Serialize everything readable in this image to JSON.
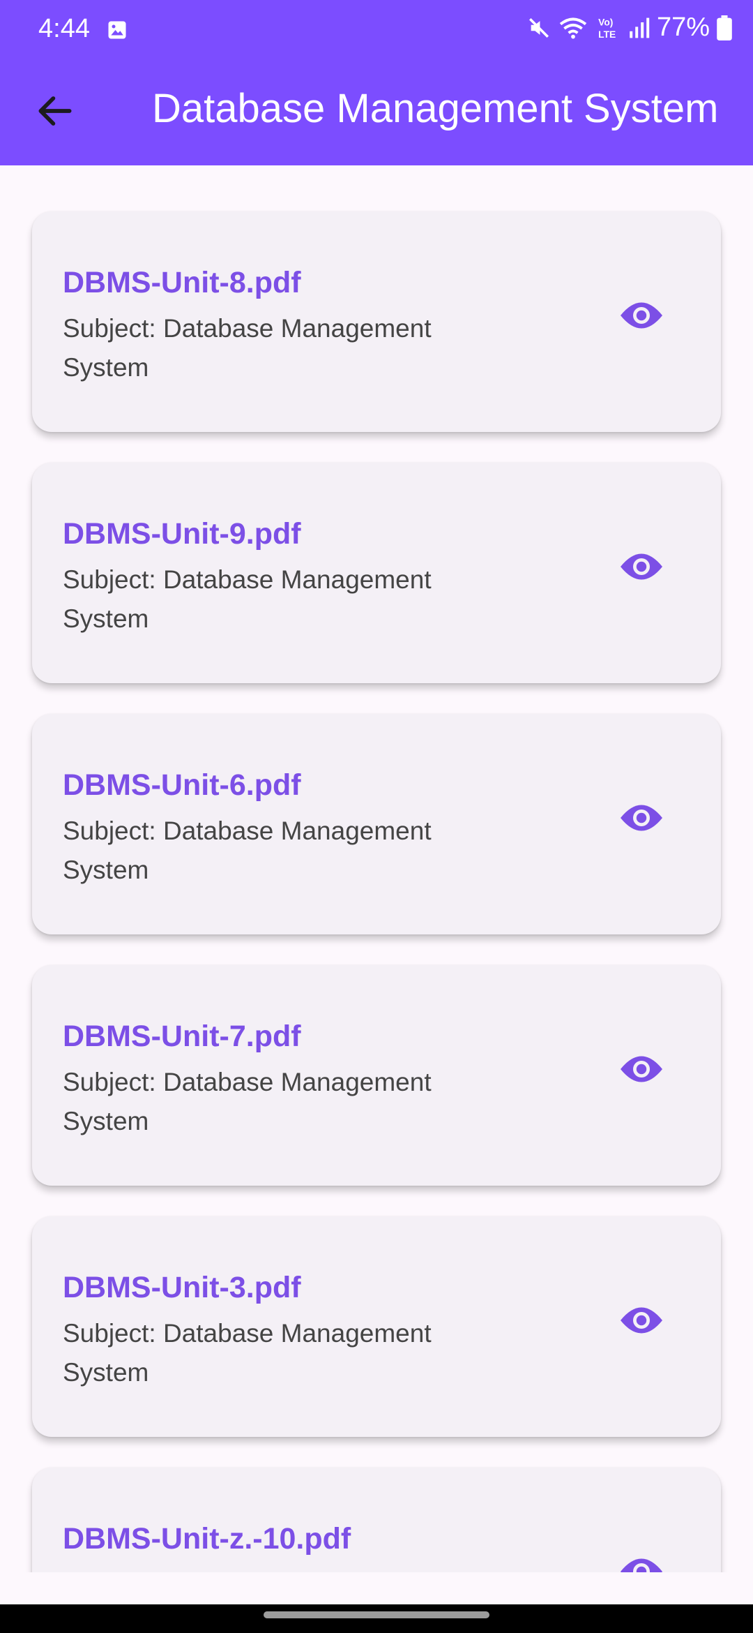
{
  "status_bar": {
    "time": "4:44",
    "battery": "77%",
    "icons": [
      "gallery-icon",
      "mute-icon",
      "wifi-icon",
      "volte-icon",
      "signal-icon",
      "battery-icon"
    ]
  },
  "app_bar": {
    "title": "Database Management System",
    "back_icon": "arrow-back-icon",
    "color": "#7c4dff"
  },
  "files": [
    {
      "name": "DBMS-Unit-8.pdf",
      "subject": "Subject:  Database Management System"
    },
    {
      "name": "DBMS-Unit-9.pdf",
      "subject": "Subject:  Database Management System"
    },
    {
      "name": "DBMS-Unit-6.pdf",
      "subject": "Subject:  Database Management System"
    },
    {
      "name": "DBMS-Unit-7.pdf",
      "subject": "Subject:  Database Management System"
    },
    {
      "name": "DBMS-Unit-3.pdf",
      "subject": "Subject:  Database Management System"
    },
    {
      "name": "DBMS-Unit-z.-10.pdf",
      "subject": ""
    }
  ],
  "view_icon": "eye-icon",
  "accent": "#7c4fe6"
}
